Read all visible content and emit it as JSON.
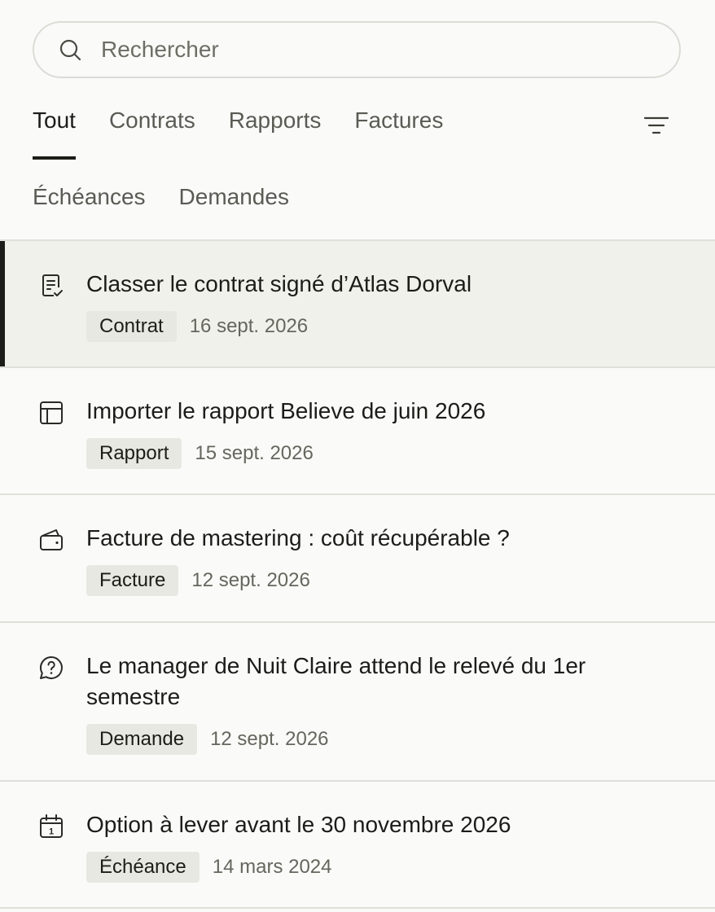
{
  "search": {
    "placeholder": "Rechercher",
    "icon": "search-icon"
  },
  "tabs": {
    "row1": [
      "Tout",
      "Contrats",
      "Rapports",
      "Factures"
    ],
    "row2": [
      "Échéances",
      "Demandes"
    ],
    "active": "Tout",
    "filter_icon": "filter-icon"
  },
  "items": [
    {
      "title": "Classer le contrat signé d’Atlas Dorval",
      "badge": "Contrat",
      "date": "16 sept. 2026",
      "icon": "contract-check-icon",
      "selected": true
    },
    {
      "title": "Importer le rapport Believe de juin 2026",
      "badge": "Rapport",
      "date": "15 sept. 2026",
      "icon": "report-table-icon"
    },
    {
      "title": "Facture de mastering : coût récupérable ?",
      "badge": "Facture",
      "date": "12 sept. 2026",
      "icon": "wallet-icon"
    },
    {
      "title": "Le manager de Nuit Claire attend le relevé du 1er semestre",
      "badge": "Demande",
      "date": "12 sept. 2026",
      "icon": "question-bubble-icon"
    },
    {
      "title": "Option à lever avant le 30 novembre 2026",
      "badge": "Échéance",
      "date": "14 mars 2024",
      "icon": "calendar-icon"
    }
  ],
  "colors": {
    "text": "#1c1c18",
    "muted": "#5b5b55",
    "selected_bg": "#f1f1ec",
    "badge_bg": "#e8e8e2",
    "border": "#e0e0da"
  }
}
